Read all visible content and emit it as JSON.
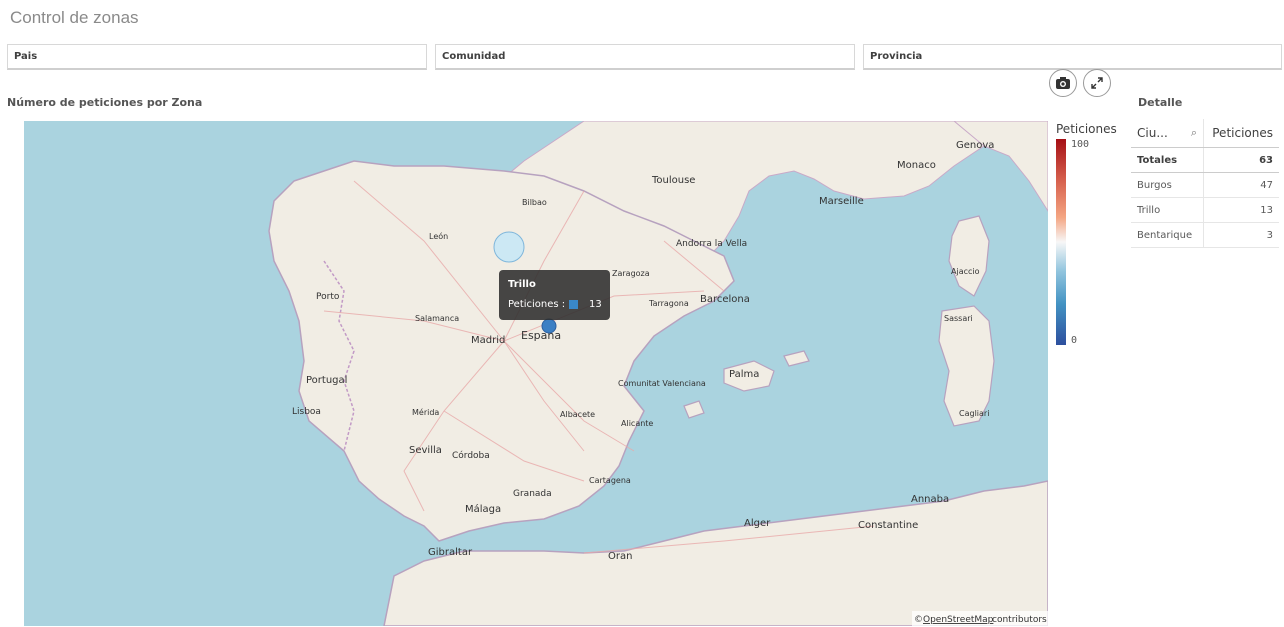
{
  "app": {
    "title": "Control de zonas"
  },
  "filters": [
    {
      "label": "Pais"
    },
    {
      "label": "Comunidad"
    },
    {
      "label": "Provincia"
    }
  ],
  "map_panel": {
    "title": "Número de peticiones por Zona",
    "buttons": {
      "snapshot_icon": "camera-icon",
      "fullscreen_icon": "expand-icon"
    },
    "legend": {
      "title": "Peticiones",
      "max": "100",
      "min": "0",
      "colors": [
        "#a50f15",
        "#f7f7f7",
        "#2d4f9e"
      ]
    },
    "tooltip": {
      "title": "Trillo",
      "label": "Peticiones :",
      "value": "13",
      "swatch_color": "#3a88c8"
    },
    "attribution": {
      "prefix": "©",
      "link": "OpenStreetMap",
      "suffix": "contributors"
    },
    "labels": {
      "spain": "España",
      "madrid": "Madrid",
      "portugal": "Portugal",
      "lisboa": "Lisboa",
      "porto": "Porto",
      "barcelona": "Barcelona",
      "valencia_region": "Comunitat Valenciana",
      "andorra": "Andorra la Vella",
      "toulouse": "Toulouse",
      "marseille": "Marseille",
      "monaco": "Monaco",
      "genova": "Genova",
      "palma": "Palma",
      "sassari": "Sassari",
      "ajaccio": "Ajaccio",
      "sevilla": "Sevilla",
      "malaga": "Málaga",
      "granada": "Granada",
      "cordoba": "Córdoba",
      "alger": "Alger",
      "oran": "Oran",
      "annaba": "Annaba",
      "constantine": "Constantine",
      "gibraltar": "Gibraltar",
      "bilbao": "Bilbao",
      "leon": "León",
      "salamanca": "Salamanca",
      "albacete": "Albacete",
      "alicante": "Alicante",
      "cartagena": "Cartagena",
      "merida": "Mérida",
      "zaragoza": "Zaragoza",
      "cagliari": "Cagliari",
      "tarragona": "Tarragona"
    }
  },
  "markers": [
    {
      "name": "Burgos",
      "value": 47,
      "color": "#c6e6f7"
    },
    {
      "name": "Trillo",
      "value": 13,
      "color": "#3b7fc4"
    }
  ],
  "detail": {
    "title": "Detalle",
    "columns": [
      "Ciu...",
      "Peticiones"
    ],
    "search_icon": "search-icon",
    "totals": {
      "label": "Totales",
      "value": "63"
    },
    "rows": [
      {
        "city": "Burgos",
        "value": "47"
      },
      {
        "city": "Trillo",
        "value": "13"
      },
      {
        "city": "Bentarique",
        "value": "3"
      }
    ]
  }
}
